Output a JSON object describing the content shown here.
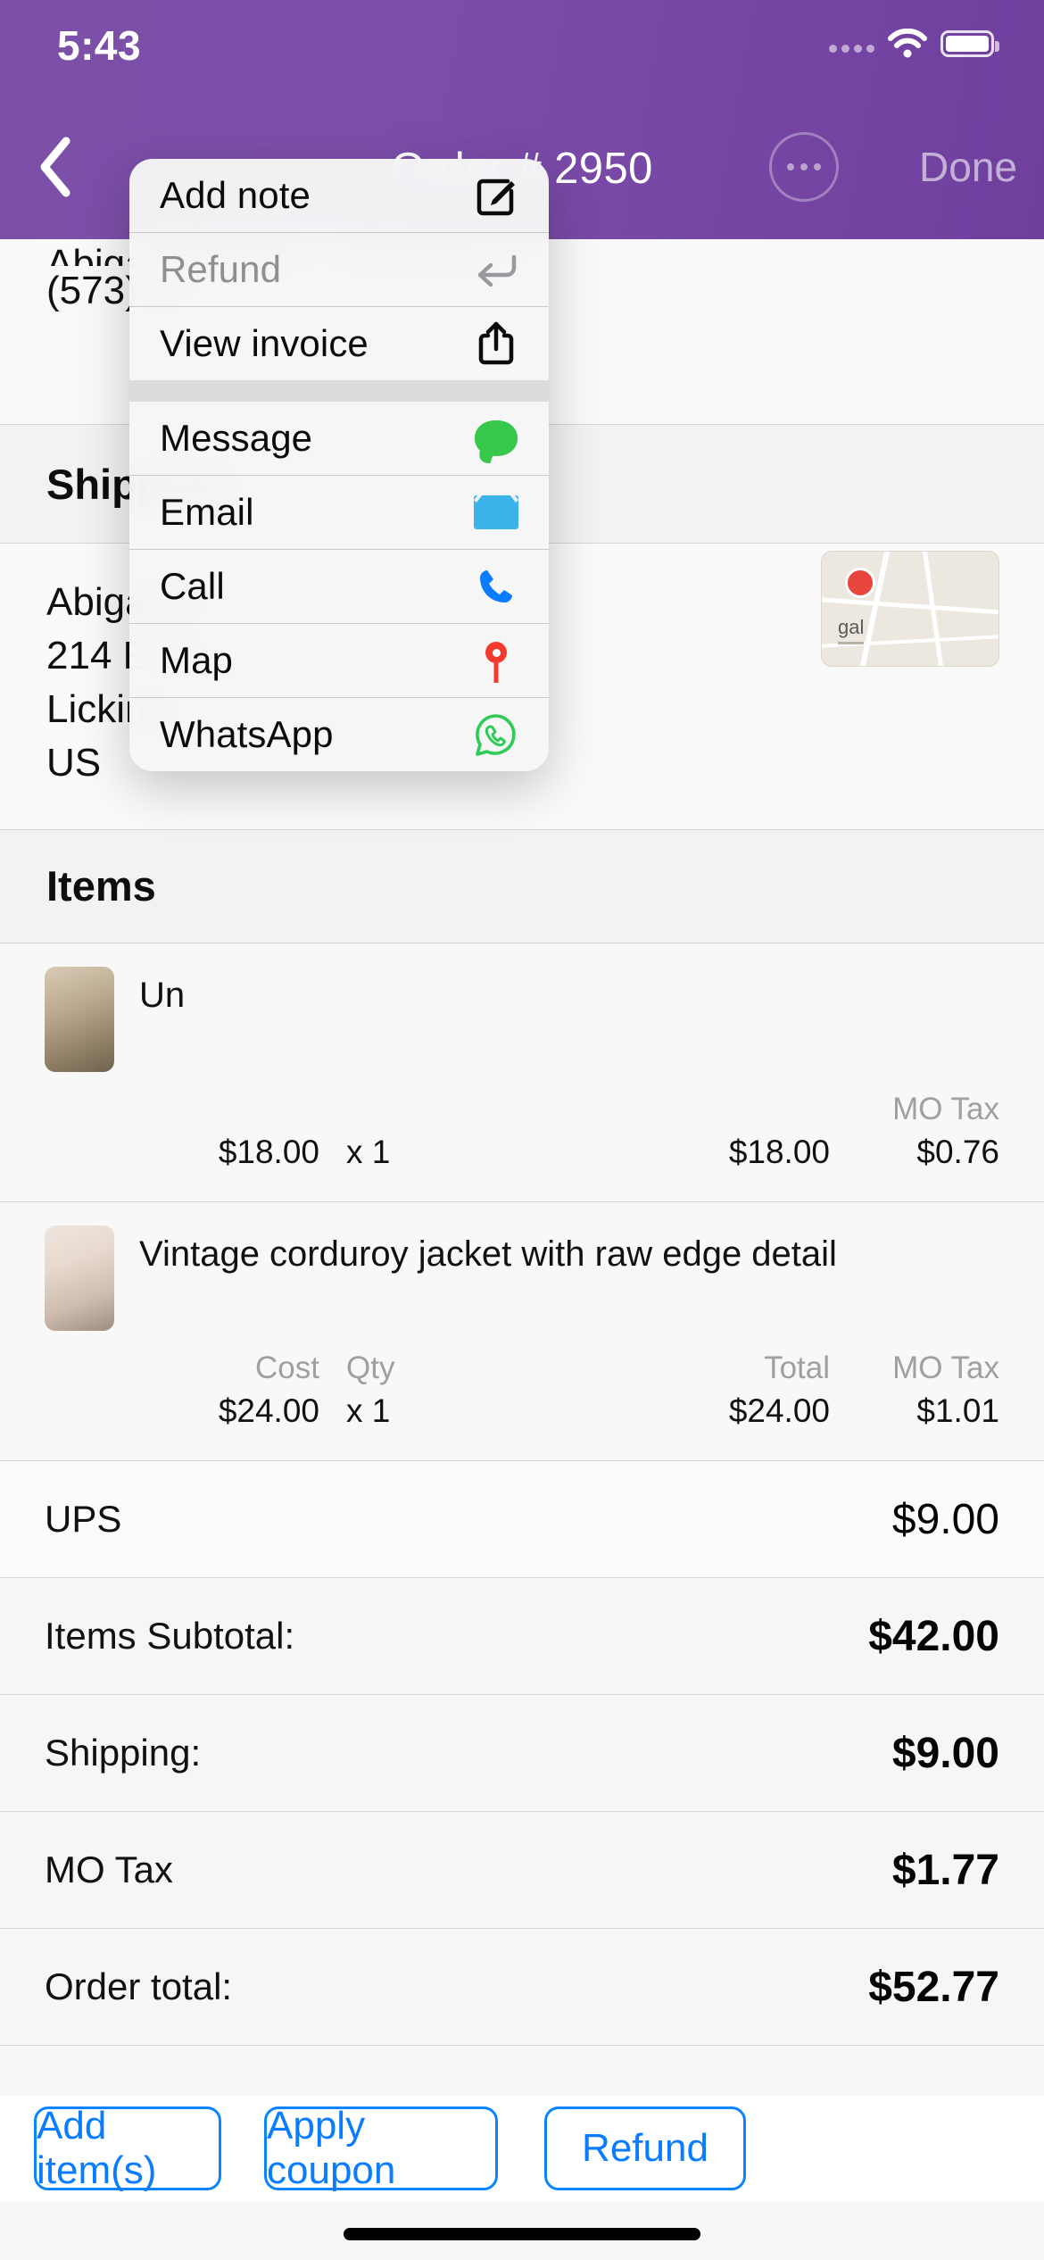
{
  "status_bar": {
    "time": "5:43",
    "wifi_icon": "wifi-icon",
    "battery_icon": "battery-icon",
    "signal_icon": "signal-dots-icon"
  },
  "nav_bar": {
    "back_icon": "chevron-left-icon",
    "title": "Order # 2950",
    "more_icon": "ellipsis-circle-icon",
    "done_label": "Done",
    "accent_color": "#7b4fa8"
  },
  "customer": {
    "name_clipped": "Abigail Shelton - Maintain",
    "phone": "(573) 67"
  },
  "shipping": {
    "header": "Shipping",
    "name": "Abigail H",
    "line1": "214 E Fri",
    "line2": "Licking,",
    "line3": "US",
    "map_label": "gal"
  },
  "items": {
    "header": "Items",
    "columns": [
      "Cost",
      "Qty",
      "Total",
      "MO Tax"
    ],
    "rows": [
      {
        "title_clipped": "Un",
        "cost": "$18.00",
        "qty": "x 1",
        "total": "$18.00",
        "tax_label": "MO Tax",
        "tax": "$0.76",
        "thumb": "product-thumbnail-crochet-top"
      },
      {
        "title": "Vintage corduroy jacket with raw edge detail",
        "cost_label": "Cost",
        "cost": "$24.00",
        "qty_label": "Qty",
        "qty": "x 1",
        "total_label": "Total",
        "total": "$24.00",
        "tax_label": "MO Tax",
        "tax": "$1.01",
        "thumb": "product-thumbnail-corduroy-jacket"
      }
    ]
  },
  "totals": [
    {
      "label": "UPS",
      "value": "$9.00",
      "bold": false
    },
    {
      "label": "Items Subtotal:",
      "value": "$42.00",
      "bold": true
    },
    {
      "label": "Shipping:",
      "value": "$9.00",
      "bold": true
    },
    {
      "label": "MO Tax",
      "value": "$1.77",
      "bold": true
    },
    {
      "label": "Order total:",
      "value": "$52.77",
      "bold": true
    }
  ],
  "action_buttons": {
    "add_items": "Add item(s)",
    "apply_coupon": "Apply coupon",
    "refund": "Refund",
    "color": "#0a7cff"
  },
  "context_menu": {
    "items": [
      {
        "label": "Add note",
        "icon": "compose-square-pencil-icon",
        "enabled": true,
        "icon_color": "#0b0b0b"
      },
      {
        "label": "Refund",
        "icon": "return-arrow-icon",
        "enabled": false,
        "icon_color": "#8e8e93"
      },
      {
        "label": "View invoice",
        "icon": "share-upload-icon",
        "enabled": true,
        "icon_color": "#0b0b0b"
      },
      {
        "label": "Message",
        "icon": "message-bubble-icon",
        "enabled": true,
        "icon_color": "#37c84b"
      },
      {
        "label": "Email",
        "icon": "envelope-icon",
        "enabled": true,
        "icon_color": "#3cb3ea"
      },
      {
        "label": "Call",
        "icon": "phone-icon",
        "enabled": true,
        "icon_color": "#0a7cff"
      },
      {
        "label": "Map",
        "icon": "map-pin-icon",
        "enabled": true,
        "icon_color": "#f43a2c"
      },
      {
        "label": "WhatsApp",
        "icon": "whatsapp-icon",
        "enabled": true,
        "icon_color": "#2ecc57"
      }
    ]
  }
}
